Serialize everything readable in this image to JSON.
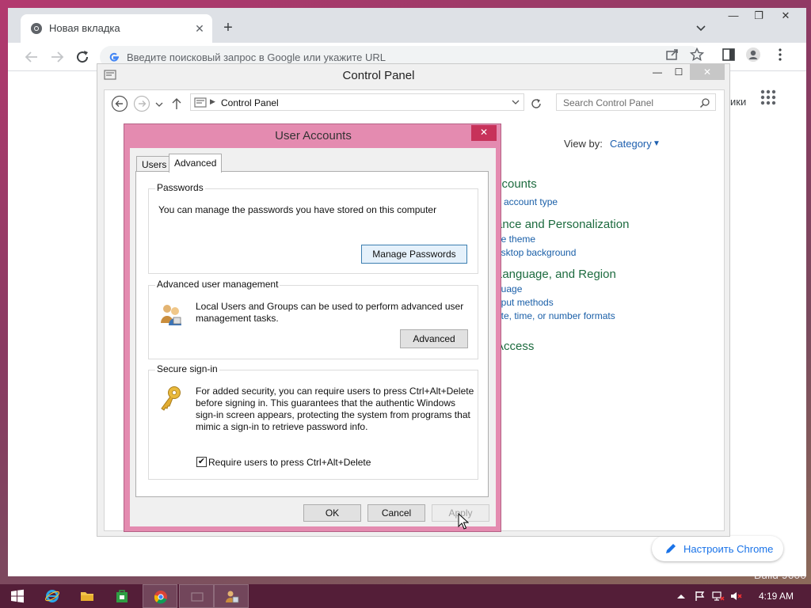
{
  "chrome": {
    "tab_title": "Новая вкладка",
    "omnibox_placeholder": "Введите поисковый запрос в Google или укажите URL",
    "ntp_links_fragment": "ики",
    "customize_label": "Настроить Chrome"
  },
  "desktop": {
    "watermark": "Build 9600"
  },
  "control_panel": {
    "title": "Control Panel",
    "breadcrumb": "Control Panel",
    "search_placeholder": "Search Control Panel",
    "view_by_label": "View by:",
    "view_by_value": "Category",
    "categories": [
      {
        "heading": "ccounts",
        "links": [
          "e account type"
        ]
      },
      {
        "heading": "ance and Personalization",
        "links": [
          "he theme",
          "esktop background"
        ]
      },
      {
        "heading": "Language, and Region",
        "links": [
          "guage",
          "nput methods",
          "ate, time, or number formats"
        ]
      },
      {
        "heading": "Access",
        "links": []
      }
    ]
  },
  "user_accounts": {
    "title": "User Accounts",
    "tabs": [
      "Users",
      "Advanced"
    ],
    "active_tab": "Advanced",
    "passwords": {
      "title": "Passwords",
      "text": "You can manage the passwords you have stored on this computer",
      "button": "Manage Passwords"
    },
    "advanced_mgmt": {
      "title": "Advanced user management",
      "text": "Local Users and Groups can be used to perform advanced user management tasks.",
      "button": "Advanced"
    },
    "secure_signin": {
      "title": "Secure sign-in",
      "text": "For added security, you can require users to press Ctrl+Alt+Delete before signing in. This guarantees that the authentic Windows sign-in screen appears, protecting the system from programs that mimic a sign-in to retrieve password info.",
      "checkbox_label": "Require users to press Ctrl+Alt+Delete",
      "checkbox_checked": true
    },
    "buttons": {
      "ok": "OK",
      "cancel": "Cancel",
      "apply": "Apply"
    }
  },
  "taskbar": {
    "time": "4:19 AM",
    "accent_color": "#541e38"
  }
}
